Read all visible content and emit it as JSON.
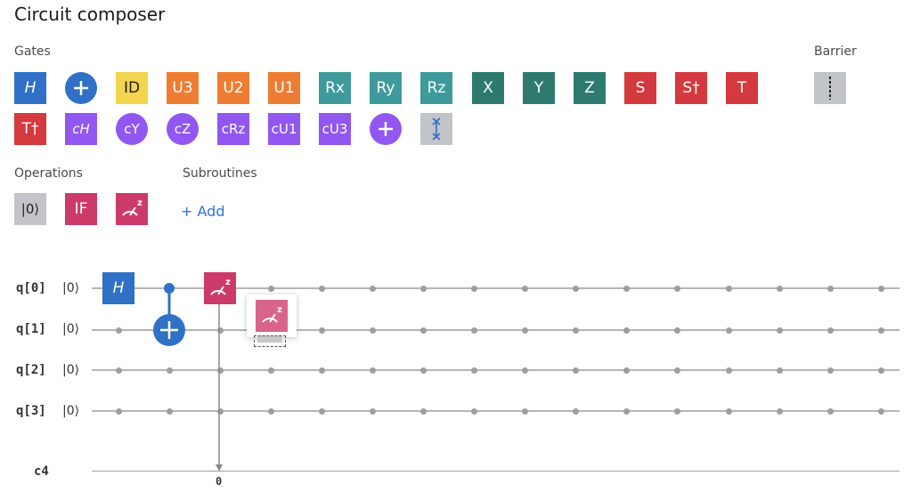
{
  "title": "Circuit composer",
  "sections": {
    "gates": "Gates",
    "barrier": "Barrier",
    "operations": "Operations",
    "subroutines": "Subroutines"
  },
  "subroutines": {
    "add_label": "+ Add"
  },
  "gates_row1": [
    "H",
    "+",
    "ID",
    "U3",
    "U2",
    "U1",
    "Rx",
    "Ry",
    "Rz",
    "X",
    "Y",
    "Z",
    "S",
    "S†",
    "T"
  ],
  "gates_row2": [
    "T†",
    "cH",
    "cY",
    "cZ",
    "cRz",
    "cU1",
    "cU3",
    "+"
  ],
  "operations": {
    "reset": "|0⟩",
    "if": "IF"
  },
  "colors": {
    "blue": "#3070c6",
    "yellow": "#f2d44f",
    "orange": "#ee7d33",
    "teal": "#3f9b9b",
    "dark_teal": "#2f7a6e",
    "red": "#d4393d",
    "purple": "#9157f0",
    "pink": "#cc3a68",
    "gray": "#c1c4c8"
  },
  "circuit": {
    "qubits": [
      {
        "label": "q[0]",
        "init": "|0⟩"
      },
      {
        "label": "q[1]",
        "init": "|0⟩"
      },
      {
        "label": "q[2]",
        "init": "|0⟩"
      },
      {
        "label": "q[3]",
        "init": "|0⟩"
      }
    ],
    "classical": {
      "label": "c4",
      "bit_index": "0"
    },
    "placed_gates": [
      {
        "gate": "H",
        "qubit": "q[0]"
      },
      {
        "gate": "CNOT",
        "control": "q[0]",
        "target": "q[1]"
      },
      {
        "gate": "measure",
        "qubit": "q[0]",
        "classical_bit": "0"
      }
    ],
    "dragging": {
      "gate": "measure"
    }
  }
}
